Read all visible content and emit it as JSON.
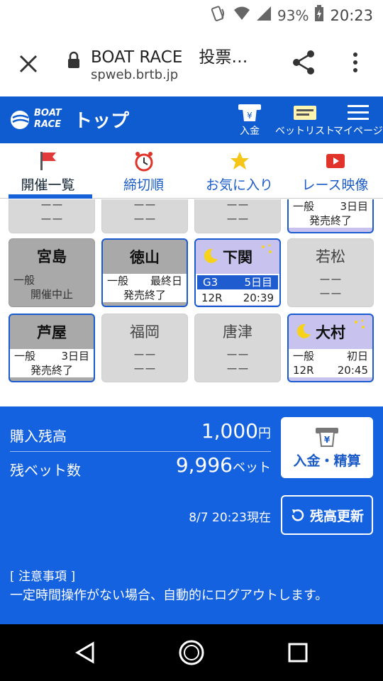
{
  "status": {
    "battery": "93%",
    "time": "20:23"
  },
  "browser": {
    "title": "BOAT RACE　投票…",
    "url": "spweb.brtb.jp"
  },
  "header": {
    "logo_line1": "BOAT",
    "logo_line2": "RACE",
    "title": "トップ",
    "deposit": "入金",
    "betlist": "ベットリスト",
    "mypage": "マイページ"
  },
  "tabs": [
    {
      "label": "開催一覧",
      "icon": "flag-icon"
    },
    {
      "label": "締切順",
      "icon": "alarm-clock-icon"
    },
    {
      "label": "お気に入り",
      "icon": "star-icon"
    },
    {
      "label": "レース映像",
      "icon": "video-icon"
    }
  ],
  "venues_partial": [
    {
      "a": "ーー",
      "b": "ーー"
    },
    {
      "a": "ーー",
      "b": "ーー"
    },
    {
      "a": "ーー",
      "b": "ーー"
    },
    {
      "grade": "一般",
      "day": "3日目",
      "status": "発売終了"
    }
  ],
  "venues_row1": [
    {
      "name": "宮島",
      "grade": "一般",
      "status": "開催中止"
    },
    {
      "name": "徳山",
      "grade": "一般",
      "day": "最終日",
      "status": "発売終了"
    },
    {
      "name": "下関",
      "grade": "G3",
      "day": "5日目",
      "race": "12R",
      "time": "20:39"
    },
    {
      "name": "若松",
      "a": "ーー",
      "b": "ーー"
    }
  ],
  "venues_row2": [
    {
      "name": "芦屋",
      "grade": "一般",
      "day": "3日目",
      "status": "発売終了"
    },
    {
      "name": "福岡",
      "a": "ーー",
      "b": "ーー"
    },
    {
      "name": "唐津",
      "a": "ーー",
      "b": "ーー"
    },
    {
      "name": "大村",
      "grade": "一般",
      "day": "初日",
      "race": "12R",
      "time": "20:45"
    }
  ],
  "balance": {
    "purchase_label": "購入残高",
    "purchase_value": "1,000",
    "purchase_unit": "円",
    "bets_label": "残ベット数",
    "bets_value": "9,996",
    "bets_unit": "ベット",
    "deposit_button": "入金・精算",
    "asof": "8/7 20:23現在",
    "refresh_button": "残高更新"
  },
  "notice": {
    "title": "[ 注意事項 ]",
    "text": "一定時間操作がない場合、自動的にログアウトします。"
  },
  "colors": {
    "brand_blue": "#1462e0",
    "header_blue": "#0f5bd0",
    "night_card": "#c8c3ee"
  }
}
